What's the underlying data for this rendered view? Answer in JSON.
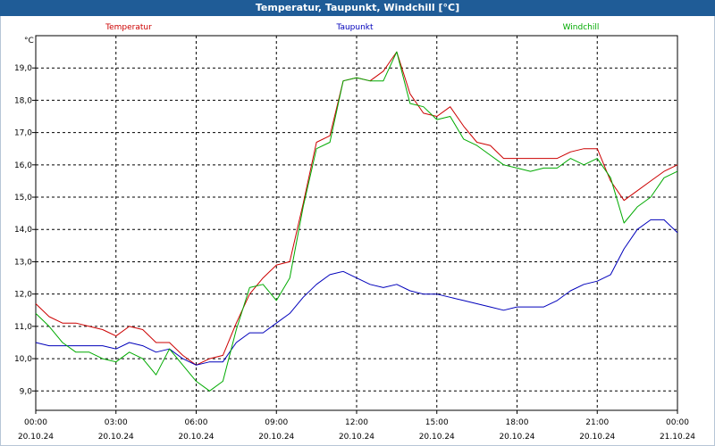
{
  "window": {
    "title": "Temperatur, Taupunkt, Windchill [°C]"
  },
  "colors": {
    "title_bar": "#1f5c97",
    "temperatur": "#cc0000",
    "taupunkt": "#0000bb",
    "windchill": "#00aa00"
  },
  "chart_data": {
    "type": "line",
    "title": "Temperatur, Taupunkt, Windchill [°C]",
    "y_unit": "°C",
    "grid": true,
    "ylim": [
      8.4,
      20.0
    ],
    "y_ticks": [
      "9,0",
      "10,0",
      "11,0",
      "12,0",
      "13,0",
      "14,0",
      "15,0",
      "16,0",
      "17,0",
      "18,0",
      "19,0"
    ],
    "y_tick_values": [
      9,
      10,
      11,
      12,
      13,
      14,
      15,
      16,
      17,
      18,
      19
    ],
    "x_tick_hours": [
      0,
      3,
      6,
      9,
      12,
      15,
      18,
      21,
      24
    ],
    "x_tick_labels": [
      [
        "00:00",
        "20.10.24"
      ],
      [
        "03:00",
        "20.10.24"
      ],
      [
        "06:00",
        "20.10.24"
      ],
      [
        "09:00",
        "20.10.24"
      ],
      [
        "12:00",
        "20.10.24"
      ],
      [
        "15:00",
        "20.10.24"
      ],
      [
        "18:00",
        "20.10.24"
      ],
      [
        "21:00",
        "20.10.24"
      ],
      [
        "00:00",
        "21.10.24"
      ]
    ],
    "x_hours": [
      0,
      0.5,
      1,
      1.5,
      2,
      2.5,
      3,
      3.5,
      4,
      4.5,
      5,
      5.5,
      6,
      6.5,
      7,
      7.5,
      8,
      8.5,
      9,
      9.5,
      10,
      10.5,
      11,
      11.5,
      12,
      12.5,
      13,
      13.5,
      14,
      14.5,
      15,
      15.5,
      16,
      16.5,
      17,
      17.5,
      18,
      18.5,
      19,
      19.5,
      20,
      20.5,
      21,
      21.5,
      22,
      22.5,
      23,
      23.5,
      24
    ],
    "series": [
      {
        "name": "Temperatur",
        "color": "#cc0000",
        "values": [
          11.7,
          11.3,
          11.1,
          11.1,
          11.0,
          10.9,
          10.7,
          11.0,
          10.9,
          10.5,
          10.5,
          10.1,
          9.8,
          10.0,
          10.1,
          11.1,
          12.0,
          12.5,
          12.9,
          13.0,
          14.8,
          16.7,
          16.9,
          18.6,
          18.7,
          18.6,
          18.9,
          19.5,
          18.2,
          17.6,
          17.5,
          17.8,
          17.2,
          16.7,
          16.6,
          16.2,
          16.2,
          16.2,
          16.2,
          16.2,
          16.4,
          16.5,
          16.5,
          15.5,
          14.9,
          15.2,
          15.5,
          15.8,
          16.0
        ]
      },
      {
        "name": "Taupunkt",
        "color": "#0000bb",
        "values": [
          10.5,
          10.4,
          10.4,
          10.4,
          10.4,
          10.4,
          10.3,
          10.5,
          10.4,
          10.2,
          10.3,
          10.0,
          9.8,
          9.9,
          9.9,
          10.5,
          10.8,
          10.8,
          11.1,
          11.4,
          11.9,
          12.3,
          12.6,
          12.7,
          12.5,
          12.3,
          12.2,
          12.3,
          12.1,
          12.0,
          12.0,
          11.9,
          11.8,
          11.7,
          11.6,
          11.5,
          11.6,
          11.6,
          11.6,
          11.8,
          12.1,
          12.3,
          12.4,
          12.6,
          13.4,
          14.0,
          14.3,
          14.3,
          13.9
        ]
      },
      {
        "name": "Windchill",
        "color": "#00aa00",
        "values": [
          11.4,
          11.0,
          10.5,
          10.2,
          10.2,
          10.0,
          9.9,
          10.2,
          10.0,
          9.5,
          10.3,
          9.8,
          9.3,
          9.0,
          9.3,
          10.9,
          12.2,
          12.3,
          11.8,
          12.5,
          14.7,
          16.5,
          16.7,
          18.6,
          18.7,
          18.6,
          18.6,
          19.5,
          17.9,
          17.8,
          17.4,
          17.5,
          16.8,
          16.6,
          16.3,
          16.0,
          15.9,
          15.8,
          15.9,
          15.9,
          16.2,
          16.0,
          16.2,
          15.6,
          14.2,
          14.7,
          15.0,
          15.6,
          15.8
        ]
      }
    ]
  }
}
